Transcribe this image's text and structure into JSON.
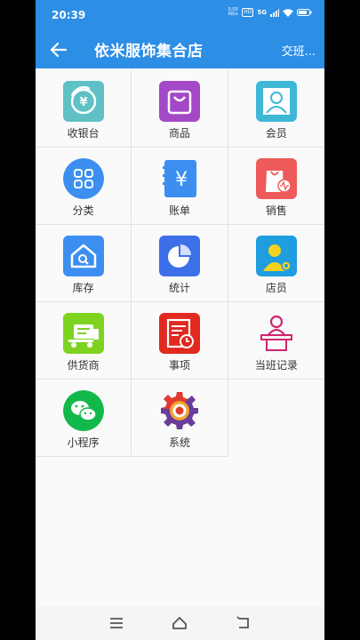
{
  "status": {
    "time": "20:39",
    "net_speed_value": "0.00",
    "net_speed_unit": "KB/s",
    "hd": "HD",
    "signal": "5G"
  },
  "appbar": {
    "title": "依米服饰集合店",
    "shift_button": "交班..."
  },
  "menu": [
    {
      "label": "收银台",
      "icon": "cashier-icon"
    },
    {
      "label": "商品",
      "icon": "goods-bag-icon"
    },
    {
      "label": "会员",
      "icon": "member-icon"
    },
    {
      "label": "分类",
      "icon": "category-grid-icon"
    },
    {
      "label": "账单",
      "icon": "bill-yen-icon"
    },
    {
      "label": "销售",
      "icon": "sales-bag-icon"
    },
    {
      "label": "库存",
      "icon": "warehouse-icon"
    },
    {
      "label": "统计",
      "icon": "pie-chart-icon"
    },
    {
      "label": "店员",
      "icon": "clerk-icon"
    },
    {
      "label": "供货商",
      "icon": "supplier-truck-icon"
    },
    {
      "label": "事项",
      "icon": "task-clock-icon"
    },
    {
      "label": "当班记录",
      "icon": "shift-record-icon"
    },
    {
      "label": "小程序",
      "icon": "mini-program-icon"
    },
    {
      "label": "系统",
      "icon": "system-gear-icon"
    }
  ],
  "colors": {
    "primary": "#2d8ee6",
    "cashier": "#5fc1c6",
    "goods": "#a349c6",
    "member": "#3fb8d6",
    "category": "#3c8ff0",
    "bill": "#3c8ff0",
    "sales": "#ef5a5a",
    "warehouse": "#3c8ff0",
    "stats": "#3c6fe8",
    "clerk": "#1f9ddf",
    "supplier": "#7ed321",
    "task": "#e0291f",
    "shift": "#d0246f",
    "mini": "#12b84a"
  }
}
